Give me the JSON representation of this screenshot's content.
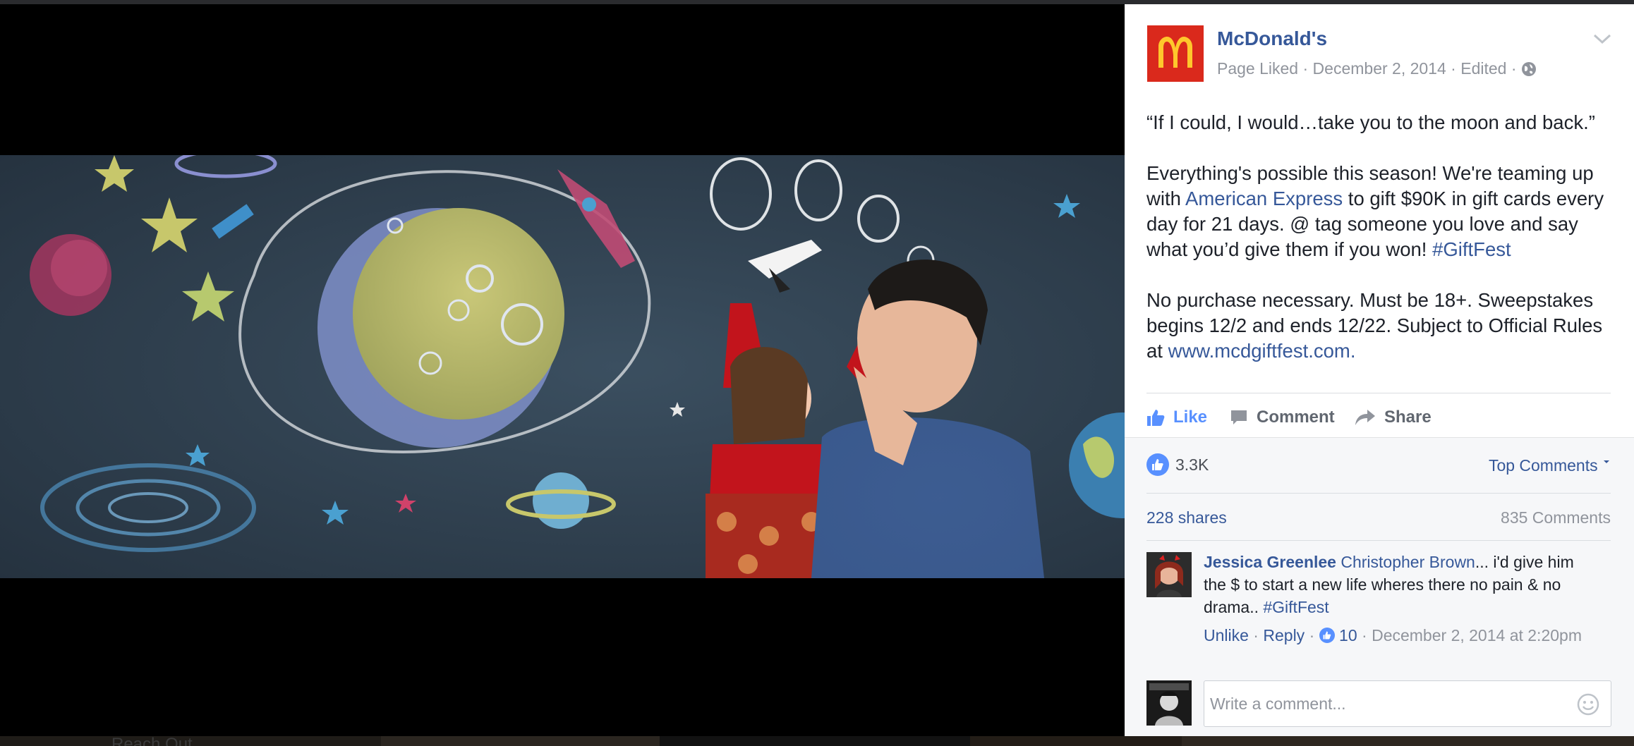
{
  "post": {
    "page_name": "McDonald's",
    "page_liked": "Page Liked",
    "date": "December 2, 2014",
    "edited": "Edited",
    "meta_sep": " · ",
    "quote": "“If I could, I would…take you to the moon and back.”",
    "para2_a": "Everything's possible this season! We're teaming up with ",
    "para2_link": "American Express",
    "para2_b": " to gift $90K in gift cards every day for 21 days. @ tag someone you love and say what you’d give them if you won! ",
    "para2_hashtag": "#GiftFest",
    "para3_a": "No purchase necessary. Must be 18+. Sweepstakes begins 12/2 and ends 12/22. Subject to Official Rules at ",
    "para3_link": "www.mcdgiftfest.com."
  },
  "actions": {
    "like": "Like",
    "comment": "Comment",
    "share": "Share"
  },
  "stats": {
    "likes": "3.3K",
    "top_comments": "Top Comments",
    "shares": "228 shares",
    "comments": "835 Comments"
  },
  "comment": {
    "author": "Jessica Greenlee",
    "mention": "Christopher Brown",
    "text": "... i'd give him the $ to start a new life wheres there no pain & no drama.. ",
    "hashtag": "#GiftFest",
    "unlike": "Unlike",
    "reply": "Reply",
    "likes": "10",
    "timestamp": "December 2, 2014 at 2:20pm",
    "sep": " · "
  },
  "composer": {
    "placeholder": "Write a comment..."
  },
  "background": {
    "partial_text": "Reach Out"
  },
  "colors": {
    "link": "#365899",
    "brand_red": "#da291c",
    "brand_yellow": "#ffc72c",
    "like_blue": "#5890ff"
  }
}
